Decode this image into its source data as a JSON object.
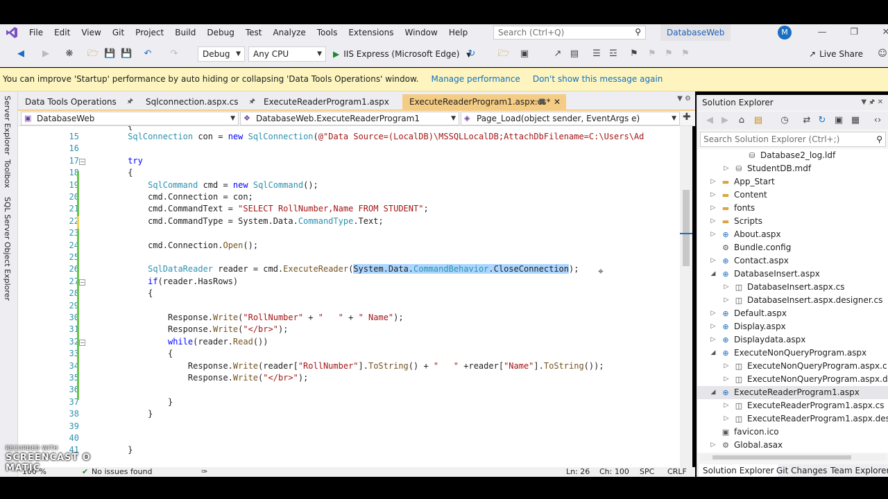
{
  "menu": {
    "items": [
      "File",
      "Edit",
      "View",
      "Git",
      "Project",
      "Build",
      "Debug",
      "Test",
      "Analyze",
      "Tools",
      "Extensions",
      "Window",
      "Help"
    ],
    "search_placeholder": "Search (Ctrl+Q)",
    "solution_name": "DatabaseWeb",
    "avatar_initial": "M"
  },
  "toolbar": {
    "config": "Debug",
    "platform": "Any CPU",
    "run_label": "IIS Express (Microsoft Edge)",
    "live_share": "Live Share"
  },
  "infobar": {
    "message": "You can improve 'Startup' performance by auto hiding or collapsing 'Data Tools Operations' window.",
    "link1": "Manage performance",
    "link2": "Don't show this message again"
  },
  "left_strip": [
    "Server Explorer",
    "Toolbox",
    "SQL Server Object Explorer"
  ],
  "doc_tabs": [
    {
      "label": "Data Tools Operations"
    },
    {
      "label": "Sqlconnection.aspx.cs"
    },
    {
      "label": "ExecuteReaderProgram1.aspx"
    },
    {
      "label": "ExecuteReaderProgram1.aspx.cs*",
      "active": true
    }
  ],
  "navbar": {
    "project": "DatabaseWeb",
    "class": "DatabaseWeb.ExecuteReaderProgram1",
    "member": "Page_Load(object sender, EventArgs e)"
  },
  "code": {
    "first_line": 15,
    "lines": [
      [
        [
          "pl",
          "        "
        ],
        [
          "ty",
          "SqlConnection"
        ],
        [
          "pl",
          " con = "
        ],
        [
          "kw",
          "new"
        ],
        [
          "pl",
          " "
        ],
        [
          "ty",
          "SqlConnection"
        ],
        [
          "pl",
          "("
        ],
        [
          "st",
          "@\"Data Source=(LocalDB)\\MSSQLLocalDB;AttachDbFilename=C:\\Users\\Ad"
        ]
      ],
      [],
      [
        [
          "pl",
          "        "
        ],
        [
          "kw",
          "try"
        ]
      ],
      [
        [
          "pl",
          "        {"
        ]
      ],
      [
        [
          "pl",
          "            "
        ],
        [
          "ty",
          "SqlCommand"
        ],
        [
          "pl",
          " cmd = "
        ],
        [
          "kw",
          "new"
        ],
        [
          "pl",
          " "
        ],
        [
          "ty",
          "SqlCommand"
        ],
        [
          "pl",
          "();"
        ]
      ],
      [
        [
          "pl",
          "            cmd.Connection = con;"
        ]
      ],
      [
        [
          "pl",
          "            cmd.CommandText = "
        ],
        [
          "st",
          "\"SELECT RollNumber,Name FROM STUDENT\""
        ],
        [
          "pl",
          ";"
        ]
      ],
      [
        [
          "pl",
          "            cmd.CommandType = System.Data."
        ],
        [
          "ty",
          "CommandType"
        ],
        [
          "pl",
          ".Text;"
        ]
      ],
      [],
      [
        [
          "pl",
          "            cmd.Connection."
        ],
        [
          "mt",
          "Open"
        ],
        [
          "pl",
          "();"
        ]
      ],
      [],
      [
        [
          "pl",
          "            "
        ],
        [
          "ty",
          "SqlDataReader"
        ],
        [
          "pl",
          " reader = cmd."
        ],
        [
          "mt",
          "ExecuteReader"
        ],
        [
          "pl",
          "("
        ],
        [
          "sel",
          "System.Data."
        ],
        [
          "selty",
          "CommandBehavior"
        ],
        [
          "sel",
          ".CloseConnection"
        ],
        [
          "pl",
          ");"
        ]
      ],
      [
        [
          "pl",
          "            "
        ],
        [
          "kw",
          "if"
        ],
        [
          "pl",
          "(reader.HasRows)"
        ]
      ],
      [
        [
          "pl",
          "            {"
        ]
      ],
      [],
      [
        [
          "pl",
          "                Response."
        ],
        [
          "mt",
          "Write"
        ],
        [
          "pl",
          "("
        ],
        [
          "st",
          "\"RollNumber\""
        ],
        [
          "pl",
          " + "
        ],
        [
          "st",
          "\"   \""
        ],
        [
          "pl",
          " + "
        ],
        [
          "st",
          "\" Name\""
        ],
        [
          "pl",
          ");"
        ]
      ],
      [
        [
          "pl",
          "                Response."
        ],
        [
          "mt",
          "Write"
        ],
        [
          "pl",
          "("
        ],
        [
          "st",
          "\"</br>\""
        ],
        [
          "pl",
          ");"
        ]
      ],
      [
        [
          "pl",
          "                "
        ],
        [
          "kw",
          "while"
        ],
        [
          "pl",
          "(reader."
        ],
        [
          "mt",
          "Read"
        ],
        [
          "pl",
          "())"
        ]
      ],
      [
        [
          "pl",
          "                {"
        ]
      ],
      [
        [
          "pl",
          "                    Response."
        ],
        [
          "mt",
          "Write"
        ],
        [
          "pl",
          "(reader["
        ],
        [
          "st",
          "\"RollNumber\""
        ],
        [
          "pl",
          "]."
        ],
        [
          "mt",
          "ToString"
        ],
        [
          "pl",
          "() + "
        ],
        [
          "st",
          "\"   \""
        ],
        [
          "pl",
          " +reader["
        ],
        [
          "st",
          "\"Name\""
        ],
        [
          "pl",
          "]."
        ],
        [
          "mt",
          "ToString"
        ],
        [
          "pl",
          "());"
        ]
      ],
      [
        [
          "pl",
          "                    Response."
        ],
        [
          "mt",
          "Write"
        ],
        [
          "pl",
          "("
        ],
        [
          "st",
          "\"</br>\""
        ],
        [
          "pl",
          ");"
        ]
      ],
      [],
      [
        [
          "pl",
          "                }"
        ]
      ],
      [
        [
          "pl",
          "            }"
        ]
      ],
      [],
      [],
      [
        [
          "pl",
          "        }"
        ]
      ]
    ]
  },
  "statusbar": {
    "zoom": "100 %",
    "issues": "No issues found",
    "ln": "Ln: 26",
    "ch": "Ch: 100",
    "spc": "SPC",
    "crlf": "CRLF"
  },
  "solution_explorer": {
    "title": "Solution Explorer",
    "search_placeholder": "Search Solution Explorer (Ctrl+;)",
    "tree": [
      {
        "label": "Database2_log.ldf",
        "indent": 4,
        "icon": "db-icon",
        "twisty": ""
      },
      {
        "label": "StudentDB.mdf",
        "indent": 3,
        "icon": "db-icon",
        "twisty": "▷"
      },
      {
        "label": "App_Start",
        "indent": 2,
        "icon": "folder-icon",
        "twisty": "▷"
      },
      {
        "label": "Content",
        "indent": 2,
        "icon": "folder-icon",
        "twisty": "▷"
      },
      {
        "label": "fonts",
        "indent": 2,
        "icon": "folder-icon",
        "twisty": "▷"
      },
      {
        "label": "Scripts",
        "indent": 2,
        "icon": "folder-icon",
        "twisty": "▷"
      },
      {
        "label": "About.aspx",
        "indent": 2,
        "icon": "web-icon",
        "twisty": "▷"
      },
      {
        "label": "Bundle.config",
        "indent": 2,
        "icon": "config-icon",
        "twisty": ""
      },
      {
        "label": "Contact.aspx",
        "indent": 2,
        "icon": "web-icon",
        "twisty": "▷"
      },
      {
        "label": "DatabaseInsert.aspx",
        "indent": 2,
        "icon": "web-icon",
        "twisty": "◢"
      },
      {
        "label": "DatabaseInsert.aspx.cs",
        "indent": 3,
        "icon": "cs-icon",
        "twisty": "▷"
      },
      {
        "label": "DatabaseInsert.aspx.designer.cs",
        "indent": 3,
        "icon": "cs-icon",
        "twisty": "▷"
      },
      {
        "label": "Default.aspx",
        "indent": 2,
        "icon": "web-icon",
        "twisty": "▷"
      },
      {
        "label": "Display.aspx",
        "indent": 2,
        "icon": "web-icon",
        "twisty": "▷"
      },
      {
        "label": "Displaydata.aspx",
        "indent": 2,
        "icon": "web-icon",
        "twisty": "▷"
      },
      {
        "label": "ExecuteNonQueryProgram.aspx",
        "indent": 2,
        "icon": "web-icon",
        "twisty": "◢"
      },
      {
        "label": "ExecuteNonQueryProgram.aspx.c",
        "indent": 3,
        "icon": "cs-icon",
        "twisty": "▷"
      },
      {
        "label": "ExecuteNonQueryProgram.aspx.d",
        "indent": 3,
        "icon": "cs-icon",
        "twisty": "▷"
      },
      {
        "label": "ExecuteReaderProgram1.aspx",
        "indent": 2,
        "icon": "web-icon",
        "twisty": "◢",
        "highlight": true
      },
      {
        "label": "ExecuteReaderProgram1.aspx.cs",
        "indent": 3,
        "icon": "cs-icon",
        "twisty": "▷"
      },
      {
        "label": "ExecuteReaderProgram1.aspx.des",
        "indent": 3,
        "icon": "cs-icon",
        "twisty": "▷"
      },
      {
        "label": "favicon.ico",
        "indent": 2,
        "icon": "image-icon",
        "twisty": ""
      },
      {
        "label": "Global.asax",
        "indent": 2,
        "icon": "gear-icon",
        "twisty": "▷"
      }
    ],
    "bottom_tabs": [
      "Solution Explorer",
      "Git Changes",
      "Team Explorer"
    ]
  },
  "watermark": {
    "small": "RECORDED WITH",
    "big": "SCREENCAST O MATIC"
  }
}
